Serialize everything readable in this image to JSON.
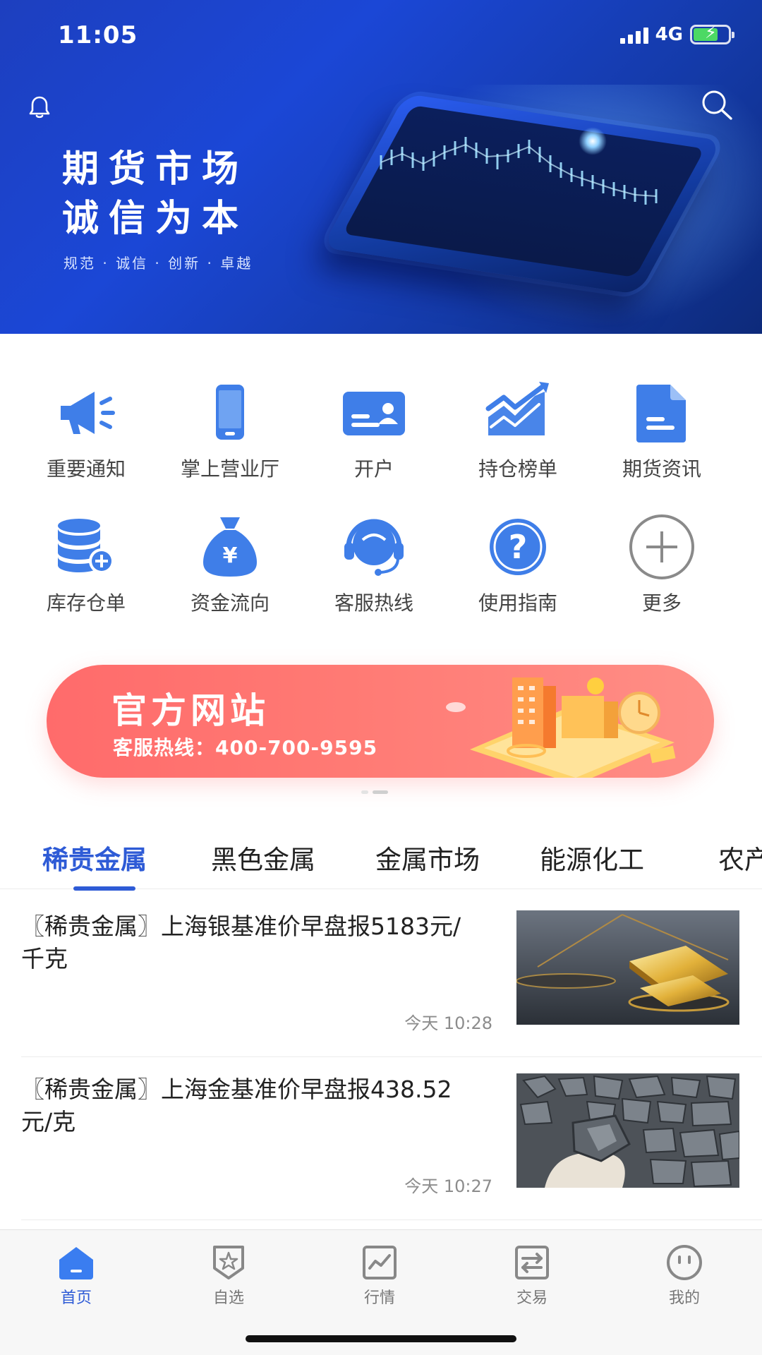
{
  "status_bar": {
    "time": "11:05",
    "network": "4G"
  },
  "hero": {
    "title_line1": "期货市场",
    "title_line2": "诚信为本",
    "subtitle": "规范 · 诚信 · 创新 · 卓越"
  },
  "menu": {
    "row1": [
      {
        "label": "重要通知",
        "icon": "megaphone-icon"
      },
      {
        "label": "掌上营业厅",
        "icon": "phone-icon"
      },
      {
        "label": "开户",
        "icon": "id-card-icon"
      },
      {
        "label": "持仓榜单",
        "icon": "trend-chart-icon"
      },
      {
        "label": "期货资讯",
        "icon": "document-icon"
      }
    ],
    "row2": [
      {
        "label": "库存仓单",
        "icon": "database-add-icon"
      },
      {
        "label": "资金流向",
        "icon": "money-bag-icon"
      },
      {
        "label": "客服热线",
        "icon": "headset-icon"
      },
      {
        "label": "使用指南",
        "icon": "question-icon"
      },
      {
        "label": "更多",
        "icon": "plus-circle-icon"
      }
    ]
  },
  "banner": {
    "title": "官方网站",
    "hotline": "客服热线：400-700-9595"
  },
  "tabs": [
    "稀贵金属",
    "黑色金属",
    "金属市场",
    "能源化工",
    "农产"
  ],
  "news": [
    {
      "title": "〖稀贵金属〗上海银基准价早盘报5183元/千克",
      "time": "今天 10:28",
      "image": "gold-scale-image"
    },
    {
      "title": "〖稀贵金属〗上海金基准价早盘报438.52元/克",
      "time": "今天 10:27",
      "image": "ore-hand-image"
    }
  ],
  "bottom_nav": [
    {
      "label": "首页",
      "icon": "home-icon"
    },
    {
      "label": "自选",
      "icon": "star-shield-icon"
    },
    {
      "label": "行情",
      "icon": "chart-line-icon"
    },
    {
      "label": "交易",
      "icon": "exchange-icon"
    },
    {
      "label": "我的",
      "icon": "profile-face-icon"
    }
  ],
  "colors": {
    "accent": "#2e5bd6",
    "icon_blue": "#3f7ee8",
    "banner_red": "#ff6b6b"
  }
}
